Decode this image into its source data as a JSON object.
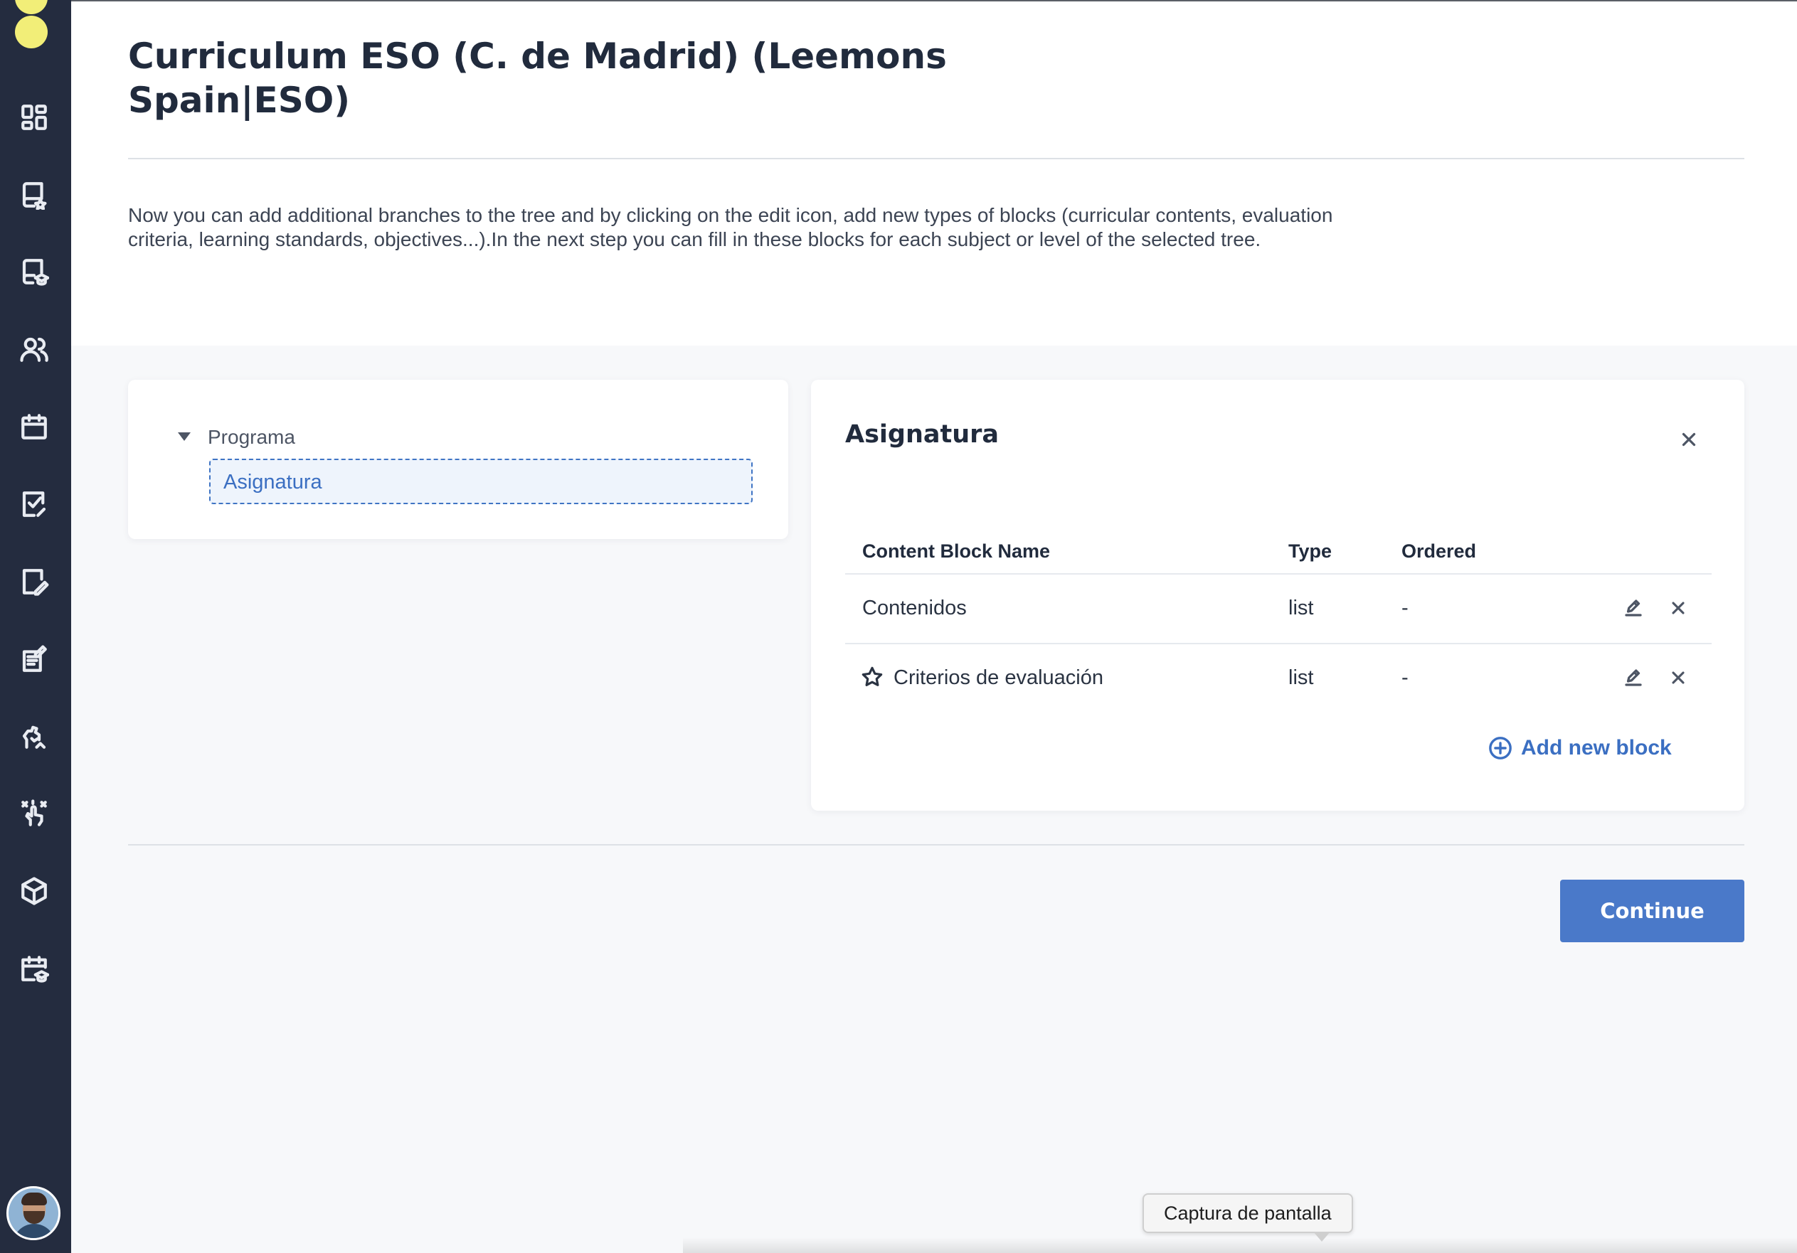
{
  "page": {
    "title": "Curriculum ESO (C. de Madrid) (Leemons Spain|ESO)",
    "description": "Now you can add additional branches to the tree and by clicking on the edit icon, add new types of blocks (curricular contents, evaluation criteria, learning standards, objectives...).In the next step you can fill in these blocks for each subject or level of the selected tree."
  },
  "sidebar": {
    "logo_color": "#F2EE78",
    "background": "#242C3F",
    "items": [
      {
        "icon": "dashboard-icon"
      },
      {
        "icon": "book-star-icon"
      },
      {
        "icon": "book-graduation-icon"
      },
      {
        "icon": "users-icon"
      },
      {
        "icon": "calendar-icon"
      },
      {
        "icon": "task-check-icon"
      },
      {
        "icon": "edit-document-icon"
      },
      {
        "icon": "notes-icon"
      },
      {
        "icon": "puzzle-hand-icon"
      },
      {
        "icon": "touch-gesture-icon"
      },
      {
        "icon": "box-icon"
      },
      {
        "icon": "calendar-graduation-icon"
      }
    ]
  },
  "tree": {
    "root": "Programa",
    "child": "Asignatura"
  },
  "detail": {
    "title": "Asignatura",
    "columns": {
      "name": "Content Block Name",
      "type": "Type",
      "ordered": "Ordered"
    },
    "rows": [
      {
        "name": "Contenidos",
        "type": "list",
        "ordered": "-",
        "starred": false
      },
      {
        "name": "Criterios de evaluación",
        "type": "list",
        "ordered": "-",
        "starred": true
      }
    ],
    "add_label": "Add new block"
  },
  "footer": {
    "continue_label": "Continue"
  },
  "tooltip": {
    "text": "Captura de pantalla"
  },
  "colors": {
    "accent": "#3B6FC2",
    "button": "#4A79C9",
    "text": "#212B3D"
  }
}
